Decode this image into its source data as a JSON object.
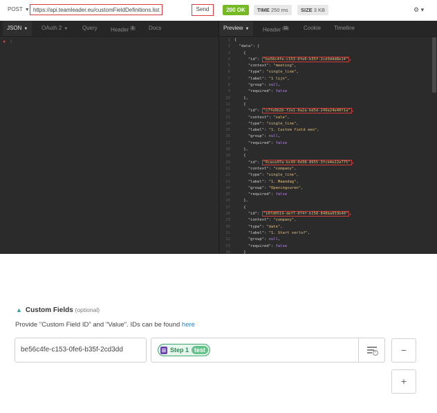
{
  "request": {
    "method": "POST",
    "url": "https://api.teamleader.eu/customFieldDefinitions.list",
    "send_label": "Send"
  },
  "response_meta": {
    "status": "200 OK",
    "time_label": "TIME",
    "time_value": "250 ms",
    "size_label": "SIZE",
    "size_value": "3 KB"
  },
  "left_tabs": [
    {
      "label": "JSON"
    },
    {
      "label": "OAuth 2"
    },
    {
      "label": "Query"
    },
    {
      "label": "Header",
      "badge": "1"
    },
    {
      "label": "Docs"
    }
  ],
  "right_tabs": [
    {
      "label": "Preview"
    },
    {
      "label": "Header",
      "badge": "11"
    },
    {
      "label": "Cookie"
    },
    {
      "label": "Timeline"
    }
  ],
  "left_editor": {
    "line_number": "1"
  },
  "response_lines": [
    {
      "n": "1",
      "html": "<span class='p'>{</span>"
    },
    {
      "n": "2",
      "html": "  <span class='k'>\"data\"</span><span class='p'>: [</span>"
    },
    {
      "n": "3",
      "html": "    <span class='p'>{</span>"
    },
    {
      "n": "4",
      "html": "      <span class='k'>\"id\"</span><span class='p'>: </span><span class='s idbox'>\"be56c4fe-c153-0fe6-b35f-2cd3ddd8e14\"</span><span class='p'>,</span>"
    },
    {
      "n": "5",
      "html": "      <span class='k'>\"context\"</span><span class='p'>: </span><span class='s'>\"meeting\"</span><span class='p'>,</span>"
    },
    {
      "n": "6",
      "html": "      <span class='k'>\"type\"</span><span class='p'>: </span><span class='s'>\"single_line\"</span><span class='p'>,</span>"
    },
    {
      "n": "7",
      "html": "      <span class='k'>\"label\"</span><span class='p'>: </span><span class='s'>\"1 lijn\"</span><span class='p'>,</span>"
    },
    {
      "n": "8",
      "html": "      <span class='k'>\"group\"</span><span class='p'>: </span><span class='n'>null</span><span class='p'>,</span>"
    },
    {
      "n": "9",
      "html": "      <span class='k'>\"required\"</span><span class='p'>: </span><span class='n'>false</span>"
    },
    {
      "n": "10",
      "html": "    <span class='p'>},</span>"
    },
    {
      "n": "11",
      "html": "    <span class='p'>{</span>"
    },
    {
      "n": "12",
      "html": "      <span class='k'>\"id\"</span><span class='p'>: </span><span class='s idbox'>\"c7fe9b2b-f2e1-0a2a-bd5d-249e24e40f1a\"</span><span class='p'>,</span>"
    },
    {
      "n": "13",
      "html": "      <span class='k'>\"context\"</span><span class='p'>: </span><span class='s'>\"sale\"</span><span class='p'>,</span>"
    },
    {
      "n": "14",
      "html": "      <span class='k'>\"type\"</span><span class='p'>: </span><span class='s'>\"single_line\"</span><span class='p'>,</span>"
    },
    {
      "n": "15",
      "html": "      <span class='k'>\"label\"</span><span class='p'>: </span><span class='s'>\"1. Custom field een\"</span><span class='p'>,</span>"
    },
    {
      "n": "16",
      "html": "      <span class='k'>\"group\"</span><span class='p'>: </span><span class='n'>null</span><span class='p'>,</span>"
    },
    {
      "n": "17",
      "html": "      <span class='k'>\"required\"</span><span class='p'>: </span><span class='n'>false</span>"
    },
    {
      "n": "18",
      "html": "    <span class='p'>},</span>"
    },
    {
      "n": "19",
      "html": "    <span class='p'>{</span>"
    },
    {
      "n": "20",
      "html": "      <span class='k'>\"id\"</span><span class='p'>: </span><span class='s idbox'>\"0cace97a-bc49-0d38-8955-3fcb4e22e775\"</span><span class='p'>,</span>"
    },
    {
      "n": "21",
      "html": "      <span class='k'>\"context\"</span><span class='p'>: </span><span class='s'>\"company\"</span><span class='p'>,</span>"
    },
    {
      "n": "22",
      "html": "      <span class='k'>\"type\"</span><span class='p'>: </span><span class='s'>\"single_line\"</span><span class='p'>,</span>"
    },
    {
      "n": "23",
      "html": "      <span class='k'>\"label\"</span><span class='p'>: </span><span class='s'>\"1. Maandag\"</span><span class='p'>,</span>"
    },
    {
      "n": "24",
      "html": "      <span class='k'>\"group\"</span><span class='p'>: </span><span class='s'>\"Openingsuren\"</span><span class='p'>,</span>"
    },
    {
      "n": "25",
      "html": "      <span class='k'>\"required\"</span><span class='p'>: </span><span class='n'>false</span>"
    },
    {
      "n": "26",
      "html": "    <span class='p'>},</span>"
    },
    {
      "n": "27",
      "html": "    <span class='p'>{</span>"
    },
    {
      "n": "28",
      "html": "      <span class='k'>\"id\"</span><span class='p'>: </span><span class='s idbox'>\"107d0519-def7-074f-b158-848ba933b40\"</span><span class='p'>,</span>"
    },
    {
      "n": "29",
      "html": "      <span class='k'>\"context\"</span><span class='p'>: </span><span class='s'>\"company\"</span><span class='p'>,</span>"
    },
    {
      "n": "30",
      "html": "      <span class='k'>\"type\"</span><span class='p'>: </span><span class='s'>\"date\"</span><span class='p'>,</span>"
    },
    {
      "n": "31",
      "html": "      <span class='k'>\"label\"</span><span class='p'>: </span><span class='s'>\"1. Start verlof\"</span><span class='p'>,</span>"
    },
    {
      "n": "32",
      "html": "      <span class='k'>\"group\"</span><span class='p'>: </span><span class='n'>null</span><span class='p'>,</span>"
    },
    {
      "n": "33",
      "html": "      <span class='k'>\"required\"</span><span class='p'>: </span><span class='n'>false</span>"
    },
    {
      "n": "34",
      "html": "    <span class='p'>}</span>"
    }
  ],
  "custom_fields": {
    "title": "Custom Fields",
    "optional": "(optional)",
    "description": "Provide \"Custom Field ID\" and \"Value\". IDs can be found",
    "link": "here",
    "id_value": "be56c4fe-c153-0fe6-b35f-2cd3dd",
    "step_label": "Step 1",
    "step_value": "test",
    "minus_label": "−",
    "plus_label": "+"
  },
  "colors": {
    "accent_teal": "#2aa7a2",
    "status_green": "#75ba24",
    "highlight_red": "#d93b3b",
    "step_purple": "#6a3fb0"
  }
}
